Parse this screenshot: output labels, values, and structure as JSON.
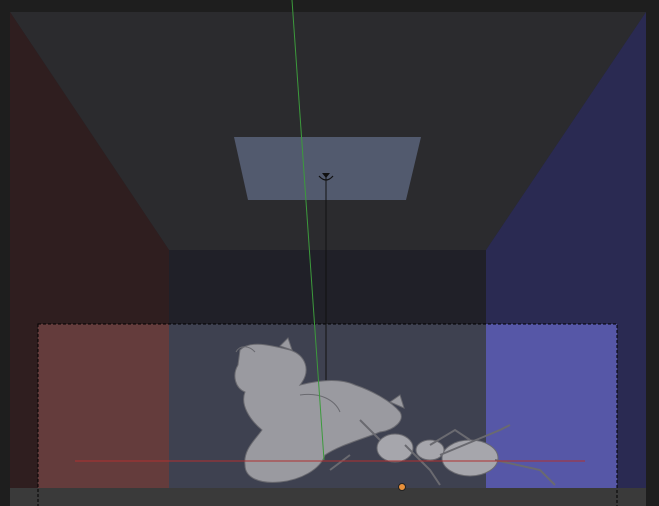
{
  "viewport": {
    "view": "camera",
    "shading": "solid",
    "colors": {
      "background": "#232327",
      "frame": "#1e1e1e",
      "ceiling": "#2b2b2e",
      "back_wall": "#202028",
      "left_wall": "#2f1e1f",
      "right_wall": "#2a2a52",
      "floor_strip": "#3a3a3a",
      "ceiling_light": "#525a6e",
      "render_left_wall": "#643c3c",
      "render_back_wall": "#3e4150",
      "render_right_wall": "#5657a7",
      "model_gray": "#9a9aa0",
      "axis_y": "#3c9a3c",
      "axis_x": "#b03030",
      "origin_dot": "#e8903a"
    }
  },
  "objects": [
    {
      "name": "cornell-box",
      "icon": "room-icon"
    },
    {
      "name": "area-light",
      "icon": "lamp-icon"
    },
    {
      "name": "dragon",
      "icon": "mesh-icon"
    },
    {
      "name": "ant",
      "icon": "mesh-icon"
    },
    {
      "name": "camera-border",
      "icon": "camera-icon"
    }
  ]
}
